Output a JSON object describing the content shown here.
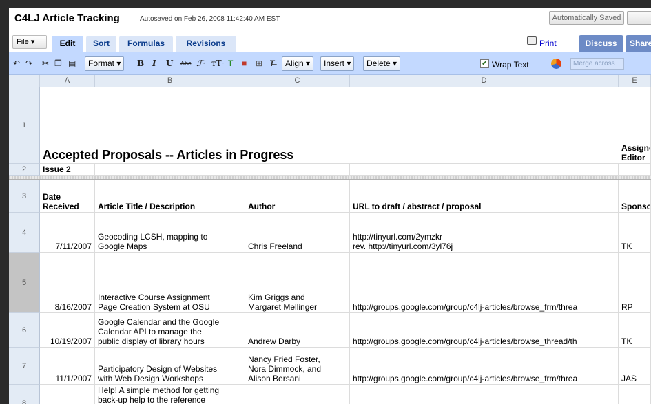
{
  "header": {
    "app_title": "C4LJ Article Tracking",
    "autosave_text": "Autosaved on Feb 26, 2008 11:42:40 AM EST",
    "saved_button": "Automatically Saved"
  },
  "tabs": {
    "file_menu": "File ▾",
    "items": [
      "Edit",
      "Sort",
      "Formulas",
      "Revisions"
    ],
    "print": "Print",
    "discuss": "Discuss",
    "share": "Share"
  },
  "toolbar": {
    "format": "Format ▾",
    "align": "Align ▾",
    "insert": "Insert ▾",
    "delete": "Delete ▾",
    "wrap_text": "Wrap Text",
    "merge_across": "Merge across",
    "wrap_checked": true
  },
  "columns": [
    "A",
    "B",
    "C",
    "D",
    "E"
  ],
  "rows": {
    "r1": {
      "num": "1",
      "title": "Accepted Proposals -- Articles in Progress",
      "e": "Assigned\nEditor"
    },
    "r2": {
      "num": "2",
      "a": "Issue 2"
    },
    "r3": {
      "num": "3",
      "a": "Date\nReceived",
      "b": "Article Title / Description",
      "c": "Author",
      "d": "URL to draft / abstract / proposal",
      "e": "Sponsor"
    },
    "r4": {
      "num": "4",
      "a": "7/11/2007",
      "b": "Geocoding LCSH, mapping to\nGoogle Maps",
      "c": "Chris Freeland",
      "d": "http://tinyurl.com/2ymzkr\nrev. http://tinyurl.com/3yl76j",
      "e": "TK"
    },
    "r5": {
      "num": "5",
      "a": "8/16/2007",
      "b": "Interactive Course Assignment\nPage Creation System at OSU",
      "c": "Kim Griggs and\nMargaret Mellinger",
      "d": "http://groups.google.com/group/c4lj-articles/browse_frm/threa",
      "e": "RP"
    },
    "r6": {
      "num": "6",
      "a": "10/19/2007",
      "b": "Google Calendar and the Google\nCalendar API to manage the\npublic display of library hours",
      "c": "Andrew Darby",
      "d": "http://groups.google.com/group/c4lj-articles/browse_thread/th",
      "e": "TK"
    },
    "r7": {
      "num": "7",
      "a": "11/1/2007",
      "b": "Participatory Design of Websites\nwith Web Design Workshops",
      "c": "Nancy Fried Foster,\nNora Dimmock, and\nAlison Bersani",
      "d": "http://groups.google.com/group/c4lj-articles/browse_frm/threa",
      "e": "JAS"
    },
    "r8": {
      "num": "8",
      "a": "",
      "b": "Help! A simple method for getting\nback-up help to the reference\ndesk",
      "c": "",
      "d": "",
      "e": ""
    }
  }
}
